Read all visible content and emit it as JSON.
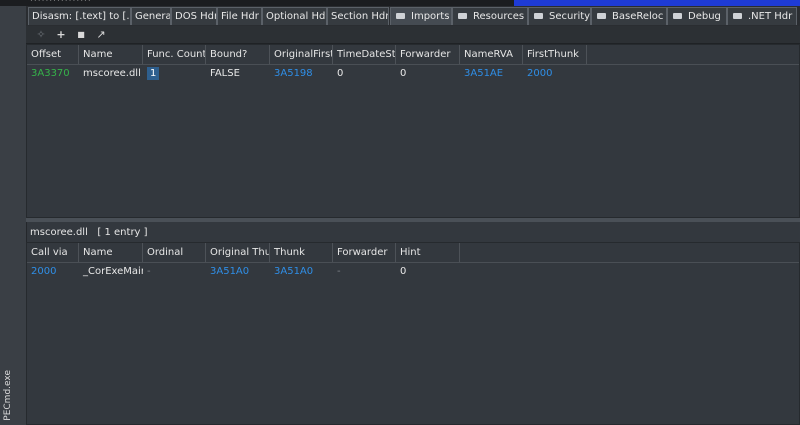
{
  "window": {
    "vertical_title": "PECmd.exe"
  },
  "top_strip_text": "················",
  "tabs": [
    {
      "label": "Disasm: [.text] to [.rsrc]"
    },
    {
      "label": "General"
    },
    {
      "label": "DOS Hdr"
    },
    {
      "label": "File Hdr"
    },
    {
      "label": "Optional Hdr"
    },
    {
      "label": "Section Hdrs"
    },
    {
      "label": "Imports"
    },
    {
      "label": "Resources"
    },
    {
      "label": "Security"
    },
    {
      "label": "BaseReloc"
    },
    {
      "label": "Debug"
    },
    {
      "label": ".NET Hdr"
    }
  ],
  "active_tab": "Imports",
  "toolbar": {
    "buttons": [
      {
        "icon": "move-icon",
        "glyph": "✧"
      },
      {
        "icon": "add-icon",
        "glyph": "+"
      },
      {
        "icon": "page-icon",
        "glyph": "■"
      },
      {
        "icon": "edit-icon",
        "glyph": "↗"
      }
    ]
  },
  "imports_table": {
    "columns": [
      "Offset",
      "Name",
      "Func. Count",
      "Bound?",
      "OriginalFirstThunk",
      "TimeDateStamp",
      "Forwarder",
      "NameRVA",
      "FirstThunk"
    ],
    "rows": [
      {
        "offset": "3A3370",
        "name": "mscoree.dll",
        "func_count": "1",
        "bound": "FALSE",
        "original_first_thunk": "3A5198",
        "timedatestamp": "0",
        "forwarder": "0",
        "name_rva": "3A51AE",
        "first_thunk": "2000"
      }
    ]
  },
  "library": {
    "name": "mscoree.dll",
    "entry_count": "[ 1 entry ]"
  },
  "functions_table": {
    "columns": [
      "Call via",
      "Name",
      "Ordinal",
      "Original Thunk",
      "Thunk",
      "Forwarder",
      "Hint"
    ],
    "rows": [
      {
        "call_via": "2000",
        "name": "_CorExeMain",
        "ordinal": "-",
        "original_thunk": "3A51A0",
        "thunk": "3A51A0",
        "forwarder": "-",
        "hint": "0"
      }
    ]
  },
  "colors": {
    "background": "#33383e",
    "rva_blue": "#2f8ee6",
    "offset_green": "#36b24a",
    "title_strip": "#1e3bd6"
  }
}
